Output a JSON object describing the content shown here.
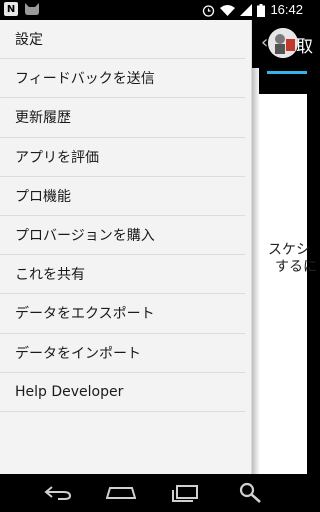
{
  "status_bar": {
    "notification_icons": [
      "n-badge-icon",
      "cat-icon"
    ],
    "n_label": "N",
    "time": "16:42",
    "icons": [
      "alarm-icon",
      "wifi-icon",
      "signal-icon",
      "battery-icon"
    ]
  },
  "app": {
    "title": "取",
    "message_line1": "スケシ",
    "message_line2": "するに"
  },
  "drawer": {
    "items": [
      {
        "label": "設定"
      },
      {
        "label": "フィードバックを送信"
      },
      {
        "label": "更新履歴"
      },
      {
        "label": "アプリを評価"
      },
      {
        "label": "プロ機能"
      },
      {
        "label": "プロバージョンを購入"
      },
      {
        "label": "これを共有"
      },
      {
        "label": "データをエクスポート"
      },
      {
        "label": "データをインポート"
      },
      {
        "label": "Help Developer"
      }
    ]
  },
  "nav_bar": {
    "icons": [
      "back-icon",
      "home-icon",
      "recent-apps-icon",
      "search-icon"
    ]
  },
  "colors": {
    "accent": "#33b5e5",
    "drawer_bg": "#f3f3f3",
    "bar_bg": "#000000"
  }
}
